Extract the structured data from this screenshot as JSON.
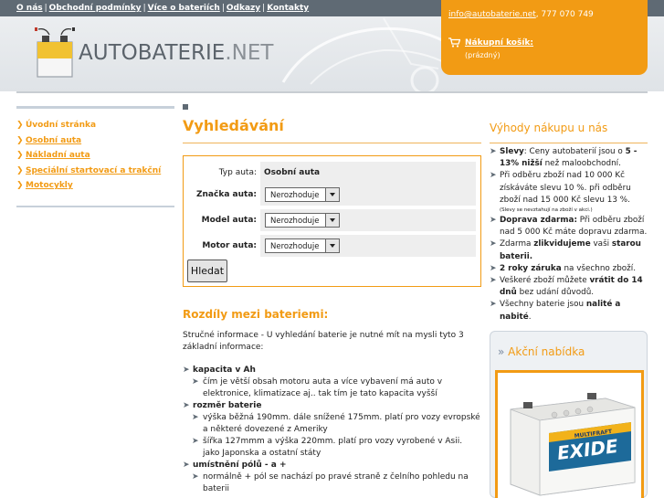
{
  "top_nav": {
    "links": [
      "O nás",
      "Obchodní podmínky",
      "Více o bateriích",
      "Odkazy",
      "Kontakty"
    ],
    "separator": "|"
  },
  "logo": {
    "brand": "AUTOBATERIE",
    "suffix": ".NET"
  },
  "contact": {
    "email": "info@autobaterie.net",
    "phone": "777 070 749"
  },
  "cart": {
    "label": "Nákupní košík:",
    "status": "(prázdný)"
  },
  "left_nav": {
    "items": [
      {
        "label": "Úvodní stránka"
      },
      {
        "label": "Osobní auta"
      },
      {
        "label": "Nákladní auta"
      },
      {
        "label": "Speciální startovací a trakční"
      },
      {
        "label": "Motocykly"
      }
    ]
  },
  "search": {
    "title": "Vyhledávání",
    "rows": [
      {
        "label": "Typ auta:",
        "value": "Osobní auta"
      },
      {
        "label": "Značka auta:",
        "value": "Nerozhoduje"
      },
      {
        "label": "Model auta:",
        "value": "Nerozhoduje"
      },
      {
        "label": "Motor auta:",
        "value": "Nerozhoduje"
      }
    ],
    "button": "Hledat"
  },
  "differences": {
    "title": "Rozdíly mezi bateriemi:",
    "intro": "Stručné informace - U vyhledání baterie je nutné mít na mysli tyto 3 základní informace:",
    "items": [
      {
        "head": "kapacita v Ah",
        "subs": [
          "čím je větší obsah motoru auta a více vybavení má auto v elektronice, klimatizace aj.. tak tím je tato kapacita vyšší"
        ]
      },
      {
        "head": "rozměr baterie",
        "subs": [
          "výška běžná 190mm. dále snížené 175mm. platí pro vozy evropské a některé dovezené z Ameriky",
          "šířka 127mmm a výška 220mm. platí pro vozy vyrobené v Asii. jako Japonska a ostatní státy"
        ]
      },
      {
        "head": "umístnění pólů - a +",
        "subs": [
          "normálně + pól se nachází po pravé straně z čelního pohledu na baterii"
        ]
      }
    ]
  },
  "benefits": {
    "title": "Výhody nákupu u nás",
    "items": [
      {
        "bold1": "Slevy",
        "text1": ": Ceny autobaterií jsou o ",
        "bold2": "5 - 13% nižší",
        "text2": " než maloobchodní."
      },
      {
        "bold1": "",
        "text1": "Při odběru zboží nad 10 000 Kč získáváte slevu 10 %. při odběru zboží nad 15 000 Kč slevu 13 %.",
        "bold2": "",
        "text2": "",
        "note": "(Slevy se nevztahují na zboží v akci.)"
      },
      {
        "bold1": "Doprava zdarma:",
        "text1": " Při odběru zboží nad 5 000 Kč máte dopravu zdarma.",
        "bold2": "",
        "text2": ""
      },
      {
        "bold1": "",
        "text1": "Zdarma ",
        "bold2": "zlikvidujeme",
        "text2": " vaši ",
        "bold3": "starou baterii."
      },
      {
        "bold1": "2 roky záruka",
        "text1": " na všechno zboží.",
        "bold2": "",
        "text2": ""
      },
      {
        "bold1": "",
        "text1": "Veškeré zboží můžete ",
        "bold2": "vrátit do 14 dnů",
        "text2": " bez udání důvodů."
      },
      {
        "bold1": "",
        "text1": "Všechny baterie jsou ",
        "bold2": "nalité a nabité",
        "text2": "."
      }
    ]
  },
  "offer": {
    "title": "Akční nabídka",
    "chevron": "»",
    "product_brand": "EXIDE",
    "product_line": "MULTIFRAFT"
  },
  "colors": {
    "accent": "#f29b14",
    "topbar": "#5f6a74",
    "link": "#f29b14"
  }
}
